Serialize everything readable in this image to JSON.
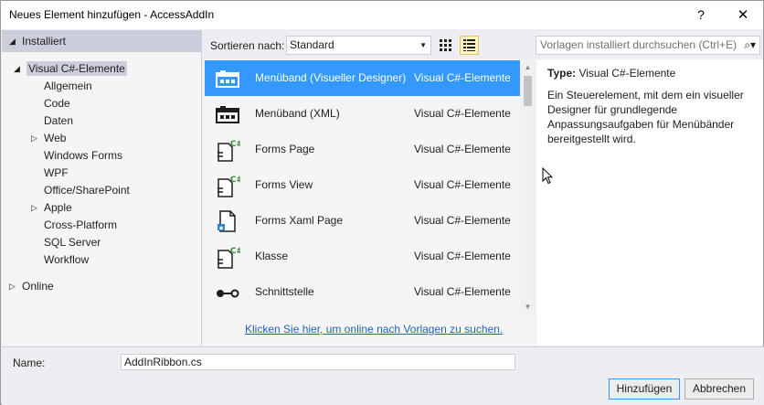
{
  "window": {
    "title": "Neues Element hinzufügen - AccessAddIn",
    "help_label": "?",
    "close_label": "✕"
  },
  "tree": {
    "installed_label": "Installiert",
    "online_label": "Online",
    "items": [
      {
        "label": "Visual C#-Elemente",
        "level": 1,
        "expanded": true,
        "selected": true
      },
      {
        "label": "Allgemein",
        "level": 2
      },
      {
        "label": "Code",
        "level": 2
      },
      {
        "label": "Daten",
        "level": 2
      },
      {
        "label": "Web",
        "level": 2,
        "collapsible": true
      },
      {
        "label": "Windows Forms",
        "level": 2
      },
      {
        "label": "WPF",
        "level": 2
      },
      {
        "label": "Office/SharePoint",
        "level": 2
      },
      {
        "label": "Apple",
        "level": 2,
        "collapsible": true
      },
      {
        "label": "Cross-Platform",
        "level": 2
      },
      {
        "label": "SQL Server",
        "level": 2
      },
      {
        "label": "Workflow",
        "level": 2
      }
    ]
  },
  "toolbar": {
    "sort_label": "Sortieren nach:",
    "sort_value": "Standard",
    "search_placeholder": "Vorlagen installiert durchsuchen (Ctrl+E)"
  },
  "templates": [
    {
      "name": "Menüband (Visueller Designer)",
      "category": "Visual C#-Elemente",
      "icon": "ribbon-icon",
      "selected": true
    },
    {
      "name": "Menüband (XML)",
      "category": "Visual C#-Elemente",
      "icon": "ribbon-icon"
    },
    {
      "name": "Forms Page",
      "category": "Visual C#-Elemente",
      "icon": "csharp-file-icon"
    },
    {
      "name": "Forms View",
      "category": "Visual C#-Elemente",
      "icon": "csharp-file-icon"
    },
    {
      "name": "Forms Xaml Page",
      "category": "Visual C#-Elemente",
      "icon": "xaml-file-icon"
    },
    {
      "name": "Klasse",
      "category": "Visual C#-Elemente",
      "icon": "csharp-file-icon"
    },
    {
      "name": "Schnittstelle",
      "category": "Visual C#-Elemente",
      "icon": "interface-icon"
    }
  ],
  "online_link": "Klicken Sie hier, um online nach Vorlagen zu suchen.",
  "details": {
    "type_label": "Type:",
    "type_value": "Visual C#-Elemente",
    "description": "Ein Steuerelement, mit dem ein visueller Designer für grundlegende Anpassungsaufgaben für Menübänder bereitgestellt wird."
  },
  "bottom": {
    "name_label": "Name:",
    "name_value": "AddInRibbon.cs",
    "add_button": "Hinzufügen",
    "cancel_button": "Abbrechen"
  },
  "colors": {
    "selection": "#3399ff",
    "link": "#1e62b9",
    "panel": "#f5f5f5",
    "chrome": "#eeeef2"
  }
}
